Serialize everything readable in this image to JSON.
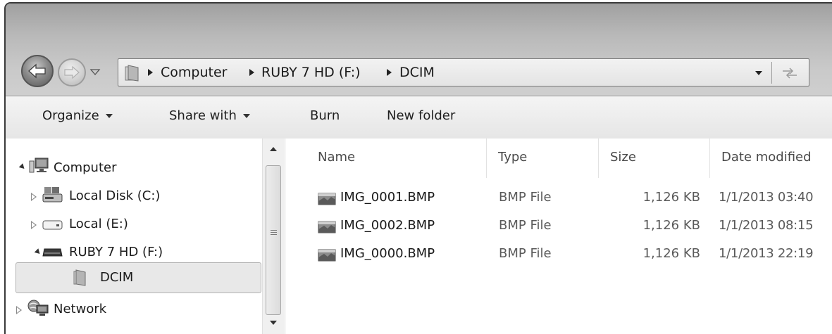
{
  "address_bar": {
    "breadcrumbs": [
      "Computer",
      "RUBY 7 HD (F:)",
      "DCIM"
    ]
  },
  "toolbar": {
    "organize": "Organize",
    "share_with": "Share with",
    "burn": "Burn",
    "new_folder": "New folder"
  },
  "navigation": {
    "computer": "Computer",
    "local_disk_c": "Local Disk (C:)",
    "local_e": "Local (E:)",
    "ruby": "RUBY 7 HD (F:)",
    "dcim": "DCIM",
    "network": "Network",
    "selected": "DCIM"
  },
  "columns": {
    "name": "Name",
    "type": "Type",
    "size": "Size",
    "date_modified": "Date modified"
  },
  "files": [
    {
      "name": "IMG_0001.BMP",
      "type": "BMP File",
      "size": "1,126 KB",
      "date": "1/1/2013 03:40"
    },
    {
      "name": "IMG_0002.BMP",
      "type": "BMP File",
      "size": "1,126 KB",
      "date": "1/1/2013 08:15"
    },
    {
      "name": "IMG_0000.BMP",
      "type": "BMP File",
      "size": "1,126 KB",
      "date": "1/1/2013 22:19"
    }
  ],
  "icons": {
    "back": "back-arrow-icon",
    "forward": "forward-arrow-icon",
    "folder": "folder-icon",
    "computer": "computer-icon",
    "drive": "drive-icon",
    "network": "network-icon",
    "image_file": "bitmap-file-icon",
    "refresh": "refresh-icon"
  }
}
